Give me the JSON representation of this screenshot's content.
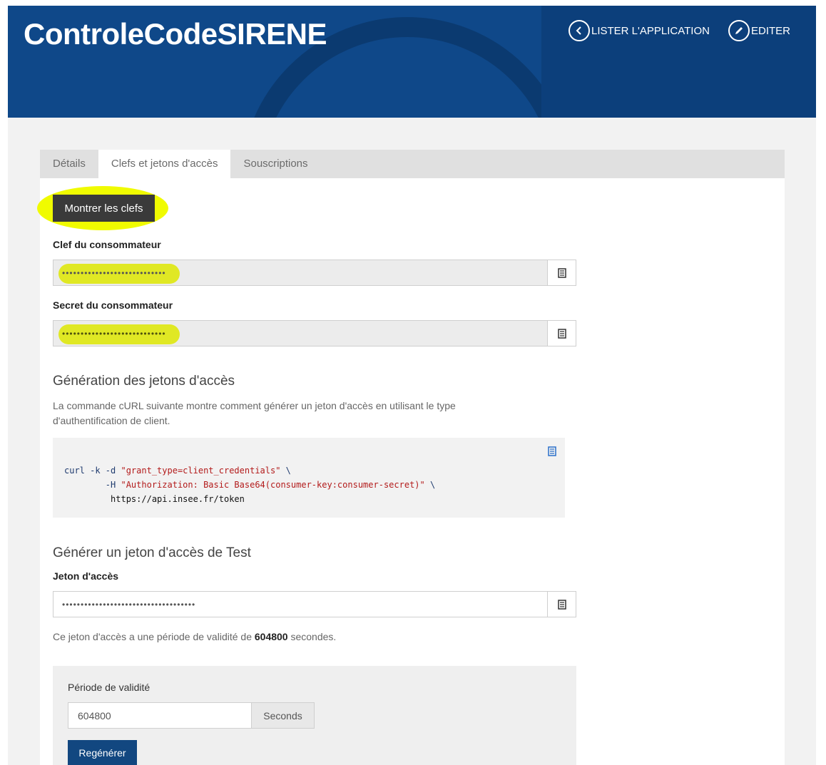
{
  "header": {
    "title": "ControleCodeSIRENE",
    "list_label": "LISTER L'APPLICATION",
    "edit_label": "EDITER"
  },
  "tabs": [
    {
      "label": "Détails",
      "active": false
    },
    {
      "label": "Clefs et jetons d'accès",
      "active": true
    },
    {
      "label": "Souscriptions",
      "active": false
    }
  ],
  "keys": {
    "show_button": "Montrer les clefs",
    "consumer_key_label": "Clef du consommateur",
    "consumer_key_value": "••••••••••••••••••••••••••••",
    "consumer_secret_label": "Secret du consommateur",
    "consumer_secret_value": "••••••••••••••••••••••••••••"
  },
  "generation": {
    "title": "Génération des jetons d'accès",
    "description": "La commande cURL suivante montre comment générer un jeton d'accès en utilisant le type d'authentification de client.",
    "code_line1_cmd": "curl -k -d ",
    "code_line1_str": "\"grant_type=client_credentials\"",
    "code_line1_end": " \\",
    "code_line2_flag": "        -H ",
    "code_line2_str": "\"Authorization: Basic Base64(consumer-key:consumer-secret)\"",
    "code_line2_end": " \\",
    "code_line3": "         https://api.insee.fr/token"
  },
  "test_token": {
    "title": "Générer un jeton d'accès de Test",
    "token_label": "Jeton d'accès",
    "token_value": "••••••••••••••••••••••••••••••••••••",
    "validity_prefix": "Ce jeton d'accès a une période de validité de ",
    "validity_value": "604800",
    "validity_suffix": " secondes.",
    "period_label": "Période de validité",
    "period_value": "604800",
    "period_unit": "Seconds",
    "regen_button": "Regénérer"
  },
  "colors": {
    "header_bg": "#0f4889",
    "highlight": "#f0fb00",
    "primary_button": "#124780"
  }
}
